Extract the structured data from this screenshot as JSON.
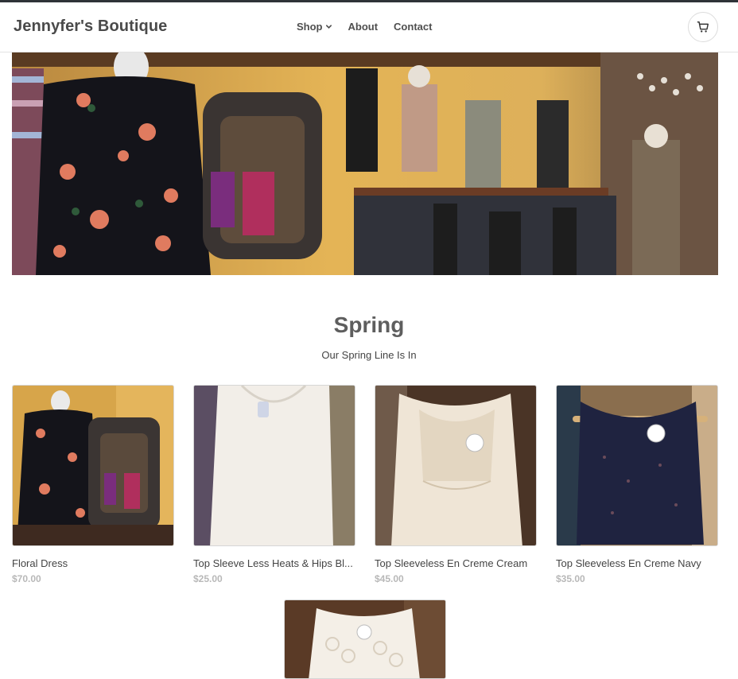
{
  "store": {
    "name": "Jennyfer's Boutique"
  },
  "nav": {
    "shop": "Shop",
    "about": "About",
    "contact": "Contact"
  },
  "section": {
    "title": "Spring",
    "subtitle": "Our Spring Line Is In"
  },
  "products": [
    {
      "name": "Floral Dress",
      "price": "$70.00"
    },
    {
      "name": "Top Sleeve Less Heats & Hips Bl...",
      "price": "$25.00"
    },
    {
      "name": "Top Sleeveless En Creme Cream",
      "price": "$45.00"
    },
    {
      "name": "Top Sleeveless En Creme Navy",
      "price": "$35.00"
    },
    {
      "name": "",
      "price": ""
    }
  ],
  "icons": {
    "cart": "shopping-cart-icon",
    "chevron": "chevron-down-icon"
  },
  "colors": {
    "topline": "#2f3338",
    "text": "#4a4a4a",
    "price": "#b8b8b8"
  }
}
